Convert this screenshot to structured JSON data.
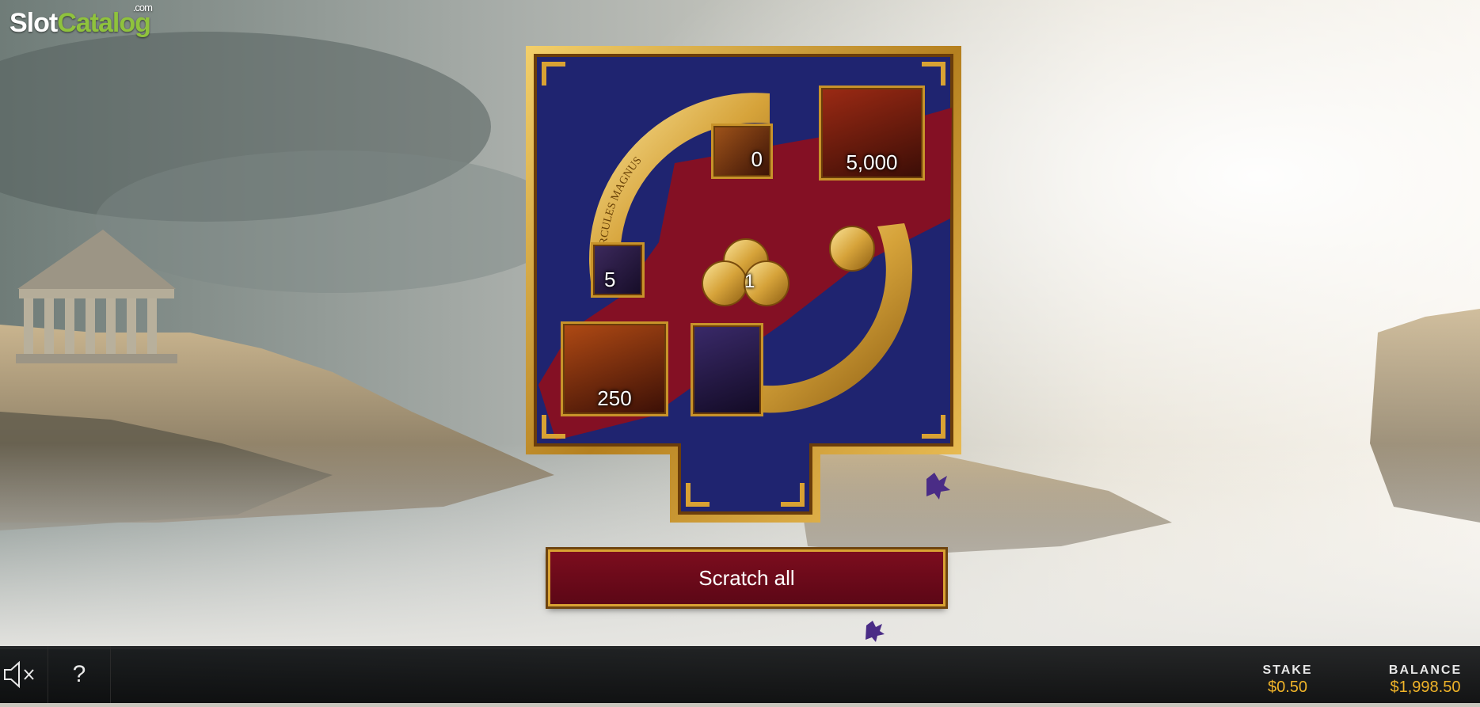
{
  "branding": {
    "logo_part1": "Slot",
    "logo_part2": "Catalog",
    "logo_suffix": ".com"
  },
  "coin": {
    "inscription": "HERCULES MAGNUS"
  },
  "prizes": [
    {
      "id": "top-middle",
      "value": "0"
    },
    {
      "id": "top-right",
      "value": "5,000"
    },
    {
      "id": "middle-left",
      "value": "5"
    },
    {
      "id": "center-coins",
      "value": "1"
    },
    {
      "id": "bottom-left",
      "value": "250"
    },
    {
      "id": "bottom-middle",
      "value": ""
    }
  ],
  "scratch_button": {
    "label": "Scratch all"
  },
  "bottom_bar": {
    "stake_label": "STAKE",
    "stake_value": "$0.50",
    "balance_label": "BALANCE",
    "balance_value": "$1,998.50",
    "help_label": "?"
  },
  "colors": {
    "gold": "#c8932a",
    "card_blue": "#1f2470",
    "card_red": "#8a1020",
    "button_red": "#7c0d1e",
    "accent_orange": "#f0b429"
  }
}
